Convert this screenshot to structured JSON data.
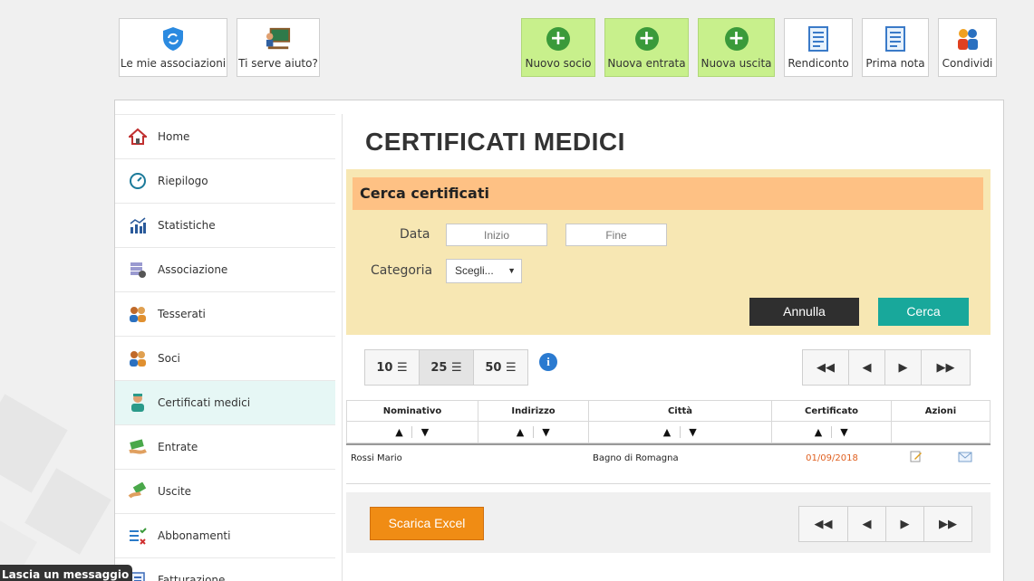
{
  "toolbar": {
    "associations": "Le mie associazioni",
    "help": "Ti serve aiuto?",
    "new_member": "Nuovo socio",
    "new_income": "Nuova entrata",
    "new_expense": "Nuova uscita",
    "report": "Rendiconto",
    "first_note": "Prima nota",
    "share": "Condividi"
  },
  "sidebar": {
    "items": [
      {
        "label": "Home",
        "icon": "home-icon"
      },
      {
        "label": "Riepilogo",
        "icon": "gauge-icon"
      },
      {
        "label": "Statistiche",
        "icon": "chart-icon"
      },
      {
        "label": "Associazione",
        "icon": "database-gear-icon"
      },
      {
        "label": "Tesserati",
        "icon": "people-icon"
      },
      {
        "label": "Soci",
        "icon": "people-icon"
      },
      {
        "label": "Certificati medici",
        "icon": "doctor-icon"
      },
      {
        "label": "Entrate",
        "icon": "money-in-icon"
      },
      {
        "label": "Uscite",
        "icon": "money-out-icon"
      },
      {
        "label": "Abbonamenti",
        "icon": "checklist-icon"
      },
      {
        "label": "Fatturazione",
        "icon": "invoice-icon"
      }
    ]
  },
  "page": {
    "title": "CERTIFICATI MEDICI"
  },
  "search": {
    "header": "Cerca certificati",
    "date_label": "Data",
    "start_placeholder": "Inizio",
    "end_placeholder": "Fine",
    "category_label": "Categoria",
    "category_value": "Scegli...",
    "cancel": "Annulla",
    "submit": "Cerca"
  },
  "pagination": {
    "sizes": [
      "10",
      "25",
      "50"
    ],
    "selected": "25"
  },
  "table": {
    "headers": [
      "Nominativo",
      "Indirizzo",
      "Città",
      "Certificato",
      "Azioni"
    ],
    "rows": [
      {
        "name": "Rossi Mario",
        "address": "",
        "city": "Bagno di Romagna",
        "certificate": "01/09/2018"
      }
    ]
  },
  "export": {
    "label": "Scarica Excel"
  },
  "chat": {
    "label": "Lascia un messaggio"
  },
  "colors": {
    "toolbar_green": "#c8f08c",
    "search_bg": "#f7e7b3",
    "search_header": "#fec184",
    "cerca": "#18a89b",
    "excel": "#f08c14",
    "certificate_date": "#e06020"
  }
}
